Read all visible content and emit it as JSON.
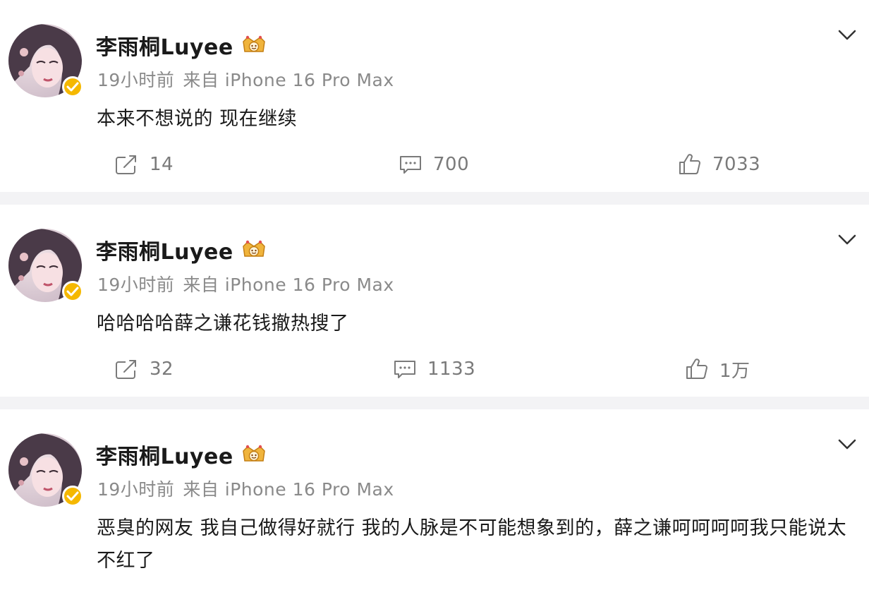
{
  "posts": [
    {
      "username": "李雨桐Luyee",
      "time": "19小时前",
      "source": "来自 iPhone 16 Pro Max",
      "content": "本来不想说的 现在继续",
      "reposts": "14",
      "comments": "700",
      "likes": "7033"
    },
    {
      "username": "李雨桐Luyee",
      "time": "19小时前",
      "source": "来自 iPhone 16 Pro Max",
      "content": "哈哈哈哈薛之谦花钱撤热搜了",
      "reposts": "32",
      "comments": "1133",
      "likes": "1万"
    },
    {
      "username": "李雨桐Luyee",
      "time": "19小时前",
      "source": "来自 iPhone 16 Pro Max",
      "content": "恶臭的网友 我自己做得好就行 我的人脉是不可能想象到的，薛之谦呵呵呵呵我只能说太不红了",
      "reposts": "",
      "comments": "",
      "likes": ""
    }
  ],
  "icons": {
    "repost": "repost-icon",
    "comment": "comment-icon",
    "like": "thumbs-up-icon",
    "menu": "chevron-down-icon",
    "verified": "verified-badge-icon",
    "vip": "crown-badge-icon"
  },
  "colors": {
    "verified_badge": "#f5b800",
    "meta_text": "#8a8a8a",
    "action_text": "#7a7a7a"
  }
}
